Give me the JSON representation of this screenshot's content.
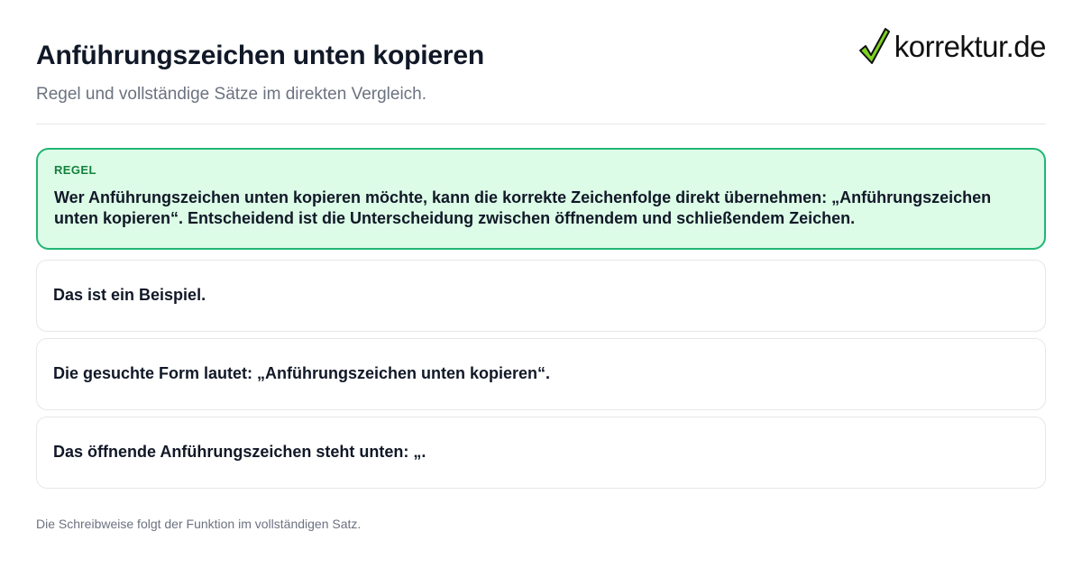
{
  "header": {
    "title": "Anführungszeichen unten kopieren",
    "subtitle": "Regel und vollständige Sätze im direkten Vergleich."
  },
  "logo": {
    "text": "korrektur.de",
    "icon": "checkmark-icon",
    "icon_color": "#7ed321"
  },
  "rule": {
    "label": "REGEL",
    "text": "Wer Anführungszeichen unten kopieren möchte, kann die korrekte Zeichenfolge direkt übernehmen: „Anführungszeichen unten kopieren“. Entscheidend ist die Unterscheidung zwischen öffnendem und schließendem Zeichen."
  },
  "examples": [
    {
      "text": "Das ist ein Beispiel."
    },
    {
      "text": "Die gesuchte Form lautet: „Anführungszeichen unten kopieren“."
    },
    {
      "text": "Das öffnende Anführungszeichen steht unten: „."
    }
  ],
  "footer": {
    "note": "Die Schreibweise folgt der Funktion im vollständigen Satz."
  },
  "colors": {
    "accent_green": "#22b573",
    "rule_background": "#dcfce7",
    "rule_label": "#15803d"
  }
}
